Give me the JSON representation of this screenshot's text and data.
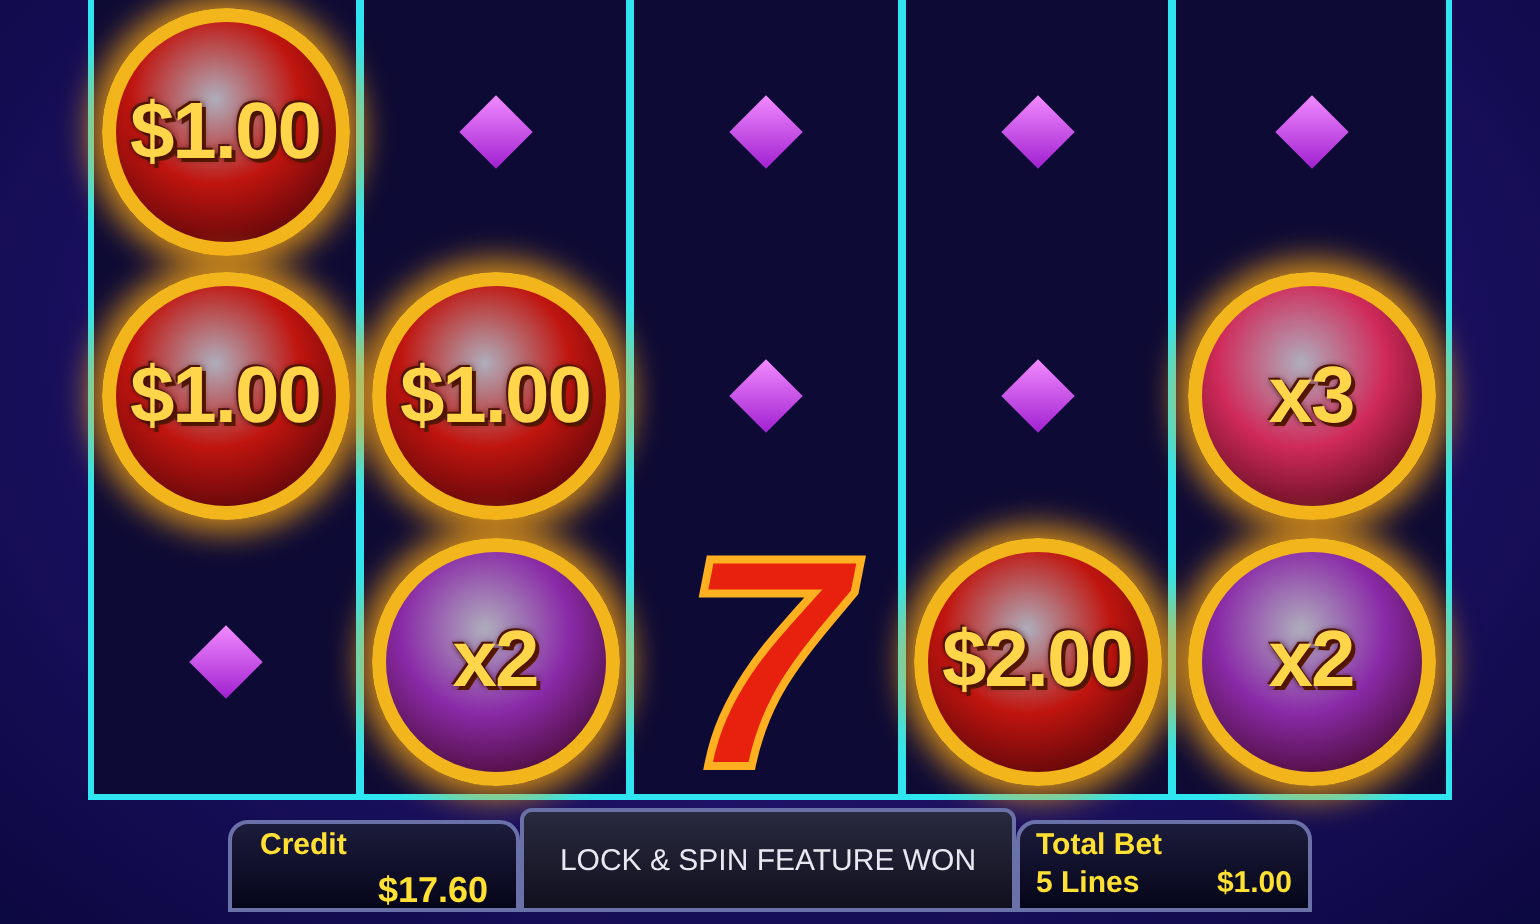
{
  "reels": {
    "rows": [
      [
        {
          "kind": "coin",
          "label": "$1.00",
          "color": "#c0150f"
        },
        {
          "kind": "blank"
        },
        {
          "kind": "blank"
        },
        {
          "kind": "blank"
        },
        {
          "kind": "blank"
        }
      ],
      [
        {
          "kind": "coin",
          "label": "$1.00",
          "color": "#c0150f"
        },
        {
          "kind": "coin",
          "label": "$1.00",
          "color": "#c0150f"
        },
        {
          "kind": "blank"
        },
        {
          "kind": "blank"
        },
        {
          "kind": "multiplier",
          "label": "x3",
          "color": "#d02a5a"
        }
      ],
      [
        {
          "kind": "blank"
        },
        {
          "kind": "multiplier",
          "label": "x2",
          "color": "#8a2aa8"
        },
        {
          "kind": "seven",
          "label": "7"
        },
        {
          "kind": "coin",
          "label": "$2.00",
          "color": "#c0150f"
        },
        {
          "kind": "multiplier",
          "label": "x2",
          "color": "#8a2aa8"
        }
      ]
    ]
  },
  "status_bar": {
    "credit_label": "Credit",
    "credit_value": "$17.60",
    "message": "LOCK & SPIN FEATURE WON",
    "bet_label": "Total Bet",
    "lines": "5 Lines",
    "bet_value": "$1.00"
  }
}
